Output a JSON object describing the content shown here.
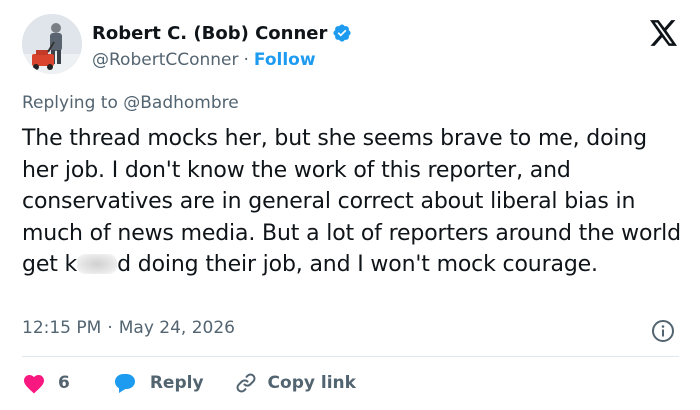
{
  "author": {
    "name": "Robert C. (Bob) Conner",
    "handle": "@RobertCConner",
    "separator": "·",
    "follow_label": "Follow"
  },
  "reply_context": {
    "prefix": "Replying to",
    "mention": "@Badhombre"
  },
  "tweet": {
    "text_before_blur": "The thread mocks her, but she seems brave to me, doing her job. I don't know the work of this reporter, and conservatives are in general correct about liberal bias in much of news media. But a lot of reporters around the world get k",
    "text_after_blur": "d doing their job, and I won't mock courage."
  },
  "meta": {
    "time": "12:15 PM",
    "separator": "·",
    "date": "May 24, 2026"
  },
  "actions": {
    "like_count": "6",
    "reply_label": "Reply",
    "copy_label": "Copy link"
  },
  "colors": {
    "accent": "#1d9bf0",
    "like": "#f91880",
    "muted": "#536471",
    "text": "#0f1419"
  },
  "icons": [
    "verified-badge-icon",
    "x-logo-icon",
    "info-icon",
    "heart-icon",
    "reply-bubble-icon",
    "link-icon"
  ]
}
